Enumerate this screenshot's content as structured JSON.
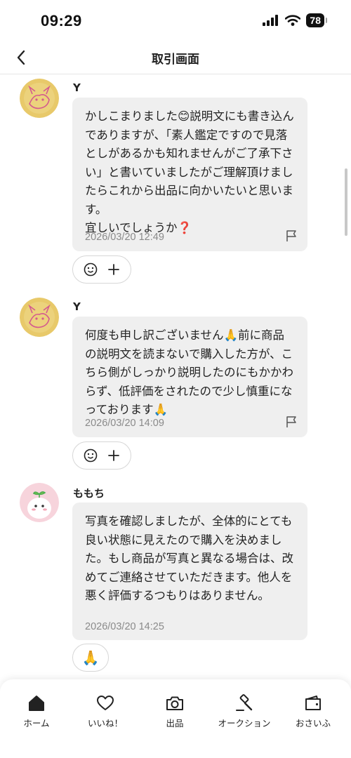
{
  "status_bar": {
    "time": "09:29",
    "battery": "78"
  },
  "header": {
    "title": "取引画面"
  },
  "messages": [
    {
      "sender": "Y",
      "text": "かしこまりました😊説明文にも書き込んでありますが、「素人鑑定ですので見落としがあるかも知れませんがご了承下さい」と書いていましたがご理解頂けましたらこれから出品に向かいたいと思います。\n宜しいでしょうか❓",
      "timestamp": "2026/03/20 12:49"
    },
    {
      "sender": "Y",
      "text": "何度も申し訳ございません🙏前に商品の説明文を読まないで購入した方が、こちら側がしっかり説明したのにもかかわらず、低評価をされたので少し慎重になっております🙏",
      "timestamp": "2026/03/20 14:09"
    },
    {
      "sender": "ももち",
      "text": "写真を確認しましたが、全体的にとても良い状態に見えたので購入を決めました。もし商品が写真と異なる場合は、改めてご連絡させていただきます。他人を悪く評価するつもりはありません。",
      "timestamp": "2026/03/20 14:25",
      "reaction": "🙏"
    }
  ],
  "tabs": [
    {
      "label": "ホーム",
      "icon": "home-icon",
      "active": true
    },
    {
      "label": "いいね！",
      "icon": "heart-icon"
    },
    {
      "label": "出品",
      "icon": "camera-icon"
    },
    {
      "label": "オークション",
      "icon": "gavel-icon"
    },
    {
      "label": "おさいふ",
      "icon": "wallet-icon"
    }
  ]
}
